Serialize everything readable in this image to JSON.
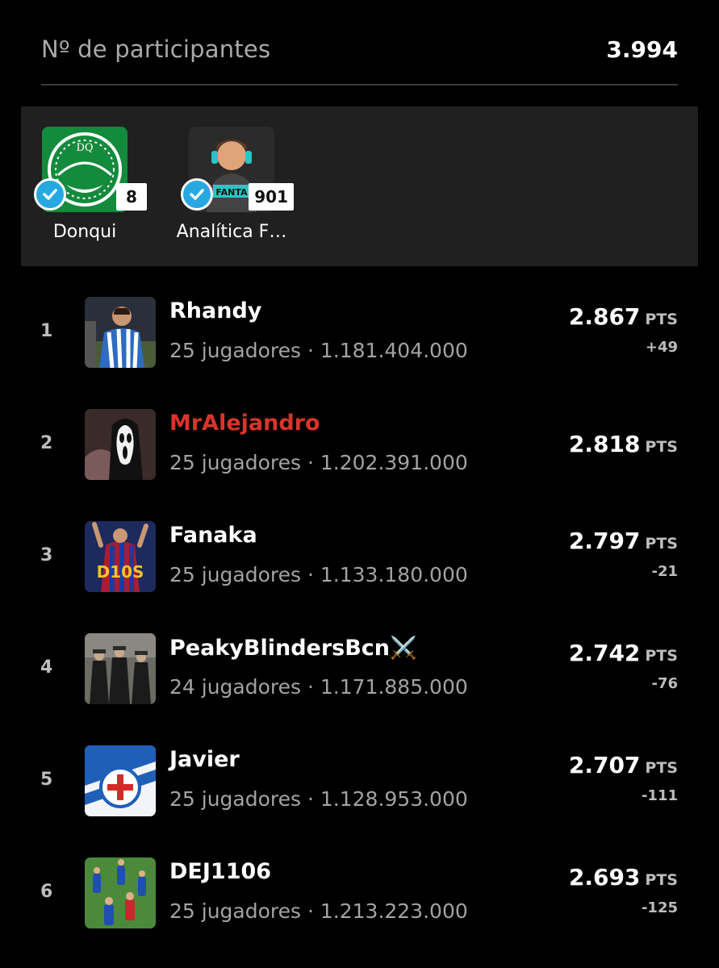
{
  "header": {
    "label": "Nº de participantes",
    "value": "3.994"
  },
  "featured": [
    {
      "name": "Donqui",
      "count": "8",
      "avatar_text": "DQ",
      "verified": true
    },
    {
      "name": "Analítica F…",
      "count": "901",
      "avatar_text": "FANTA",
      "verified": true
    }
  ],
  "ranking": [
    {
      "rank": "1",
      "name": "Rhandy",
      "sub": "25 jugadores · 1.181.404.000",
      "points": "2.867",
      "unit": "PTS",
      "delta": "+49",
      "highlight": false
    },
    {
      "rank": "2",
      "name": "MrAlejandro",
      "sub": "25 jugadores · 1.202.391.000",
      "points": "2.818",
      "unit": "PTS",
      "delta": "",
      "highlight": true
    },
    {
      "rank": "3",
      "name": "Fanaka",
      "sub": "25 jugadores · 1.133.180.000",
      "points": "2.797",
      "unit": "PTS",
      "delta": "-21",
      "highlight": false,
      "avatar_text": "D10S"
    },
    {
      "rank": "4",
      "name": "PeakyBlindersBcn⚔️",
      "sub": "24 jugadores · 1.171.885.000",
      "points": "2.742",
      "unit": "PTS",
      "delta": "-76",
      "highlight": false
    },
    {
      "rank": "5",
      "name": "Javier",
      "sub": "25 jugadores · 1.128.953.000",
      "points": "2.707",
      "unit": "PTS",
      "delta": "-111",
      "highlight": false
    },
    {
      "rank": "6",
      "name": "DEJ1106",
      "sub": "25 jugadores · 1.213.223.000",
      "points": "2.693",
      "unit": "PTS",
      "delta": "-125",
      "highlight": false
    }
  ],
  "colors": {
    "background": "#000000",
    "panel": "#202020",
    "verified": "#27a8e0",
    "highlight_name": "#d9342b"
  }
}
